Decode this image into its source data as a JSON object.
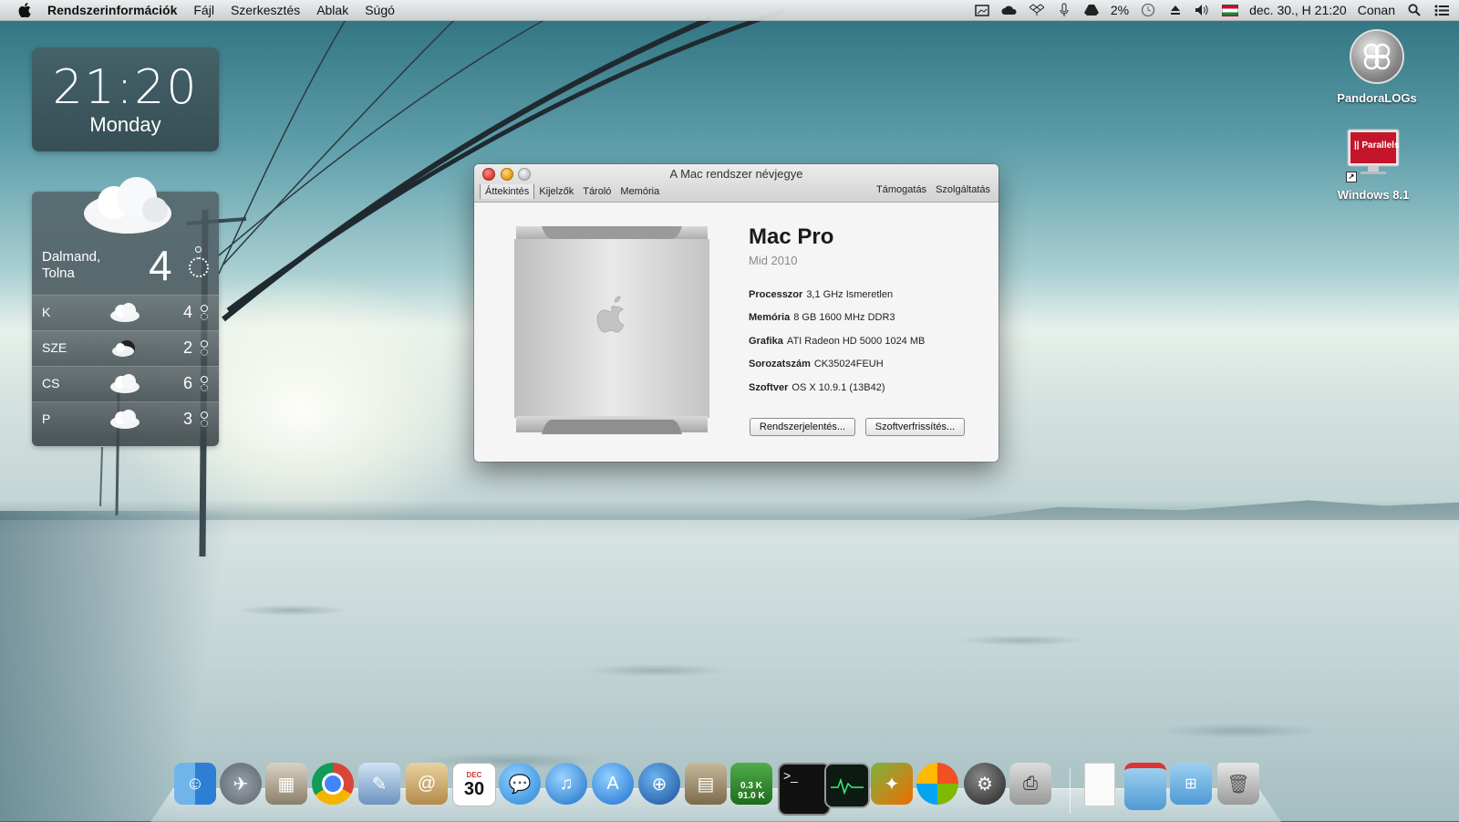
{
  "menubar": {
    "app_name": "Rendszerinformációk",
    "menus": [
      "Fájl",
      "Szerkesztés",
      "Ablak",
      "Súgó"
    ],
    "battery": "2%",
    "datetime": "dec. 30., H 21:20",
    "user": "Conan"
  },
  "clock_widget": {
    "time": "21:20",
    "day": "Monday"
  },
  "weather_widget": {
    "location_line1": "Dalmand,",
    "location_line2": "Tolna",
    "current_temp": "4",
    "forecast": [
      {
        "day": "K",
        "temp": "4",
        "icon": "cloud-icon"
      },
      {
        "day": "SZE",
        "temp": "2",
        "icon": "cloud-moon-icon"
      },
      {
        "day": "CS",
        "temp": "6",
        "icon": "cloud-icon"
      },
      {
        "day": "P",
        "temp": "3",
        "icon": "cloud-icon"
      }
    ]
  },
  "desktop_icons": [
    {
      "label": "PandoraLOGs",
      "icon": "pandora-logo-icon"
    },
    {
      "label": "Windows 8.1",
      "icon": "parallels-icon",
      "image_text": "|| Parallels"
    }
  ],
  "window": {
    "title": "A Mac rendszer névjegye",
    "tabs_left": [
      "Áttekintés",
      "Kijelzők",
      "Tároló",
      "Memória"
    ],
    "tabs_right": [
      "Támogatás",
      "Szolgáltatás"
    ],
    "model": "Mac Pro",
    "year": "Mid 2010",
    "specs": [
      {
        "label": "Processzor",
        "value": "3,1 GHz Ismeretlen"
      },
      {
        "label": "Memória",
        "value": "8 GB 1600 MHz DDR3"
      },
      {
        "label": "Grafika",
        "value": "ATI Radeon HD 5000 1024 MB"
      },
      {
        "label": "Sorozatszám",
        "value": "CK35024FEUH"
      },
      {
        "label": "Szoftver",
        "value": "OS X 10.9.1 (13B42)"
      }
    ],
    "buttons": {
      "report": "Rendszerjelentés...",
      "update": "Szoftverfrissítés..."
    }
  },
  "dock": {
    "calendar_month": "DEC",
    "calendar_day": "30",
    "net_up": "0.3 K",
    "net_down": "91.0 K",
    "items": [
      "finder-icon",
      "launchpad-icon",
      "image-capture-icon",
      "chrome-icon",
      "preview-icon",
      "contacts-icon",
      "calendar-icon",
      "messages-icon",
      "itunes-icon",
      "app-store-icon",
      "utility-icon",
      "store-icon",
      "network-monitor-icon",
      "terminal-icon",
      "activity-monitor-icon",
      "utilities-icon",
      "windows-icon",
      "steam-icon",
      "printer-icon",
      "document-icon",
      "folder-red-icon",
      "folder-windows-icon",
      "trash-icon"
    ]
  }
}
